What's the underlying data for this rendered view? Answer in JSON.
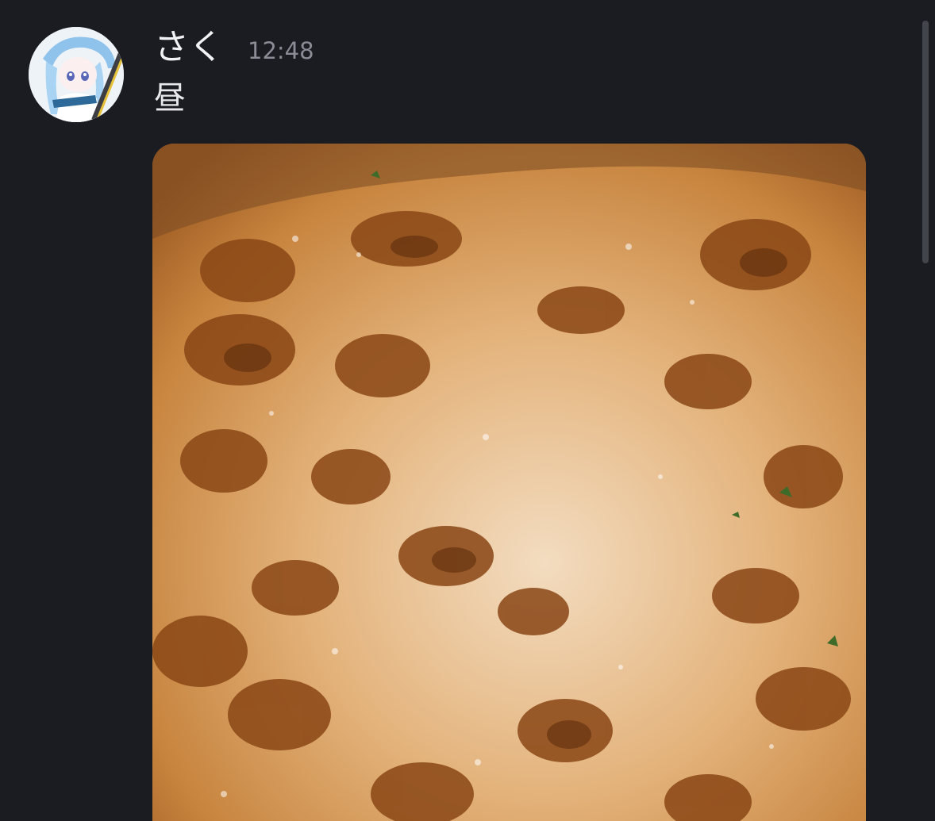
{
  "message": {
    "author": "さく",
    "time": "12:48",
    "text": "昼"
  },
  "icons": {
    "avatar": "anime-avatar-image",
    "attachment": "food-photo-image"
  },
  "colors": {
    "background": "#1b1c22",
    "author_text": "#f2f2f4",
    "timestamp_text": "#8b8d96"
  }
}
